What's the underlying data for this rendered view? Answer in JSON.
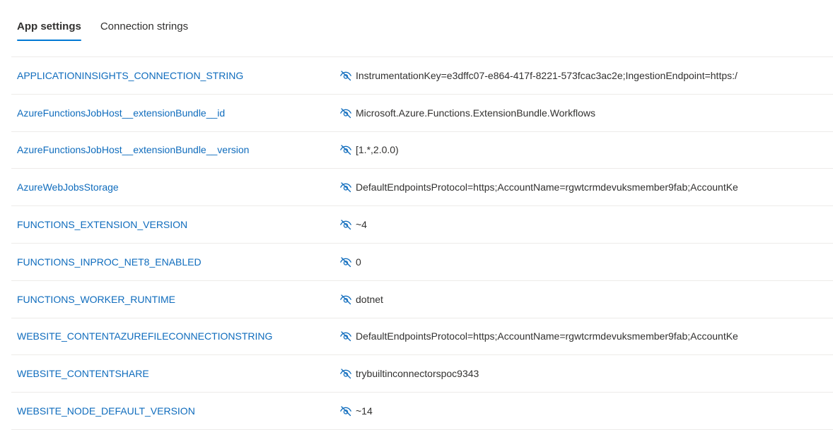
{
  "tabs": [
    {
      "label": "App settings",
      "active": true
    },
    {
      "label": "Connection strings",
      "active": false
    }
  ],
  "accent_color": "#0078d4",
  "link_color": "#0f6cbd",
  "value_icon": "eye-slash-icon",
  "settings": [
    {
      "name": "APPLICATIONINSIGHTS_CONNECTION_STRING",
      "value": "InstrumentationKey=e3dffc07-e864-417f-8221-573fcac3ac2e;IngestionEndpoint=https:/"
    },
    {
      "name": "AzureFunctionsJobHost__extensionBundle__id",
      "value": "Microsoft.Azure.Functions.ExtensionBundle.Workflows"
    },
    {
      "name": "AzureFunctionsJobHost__extensionBundle__version",
      "value": "[1.*,2.0.0)"
    },
    {
      "name": "AzureWebJobsStorage",
      "value": "DefaultEndpointsProtocol=https;AccountName=rgwtcrmdevuksmember9fab;AccountKe"
    },
    {
      "name": "FUNCTIONS_EXTENSION_VERSION",
      "value": "~4"
    },
    {
      "name": "FUNCTIONS_INPROC_NET8_ENABLED",
      "value": "0"
    },
    {
      "name": "FUNCTIONS_WORKER_RUNTIME",
      "value": "dotnet"
    },
    {
      "name": "WEBSITE_CONTENTAZUREFILECONNECTIONSTRING",
      "value": "DefaultEndpointsProtocol=https;AccountName=rgwtcrmdevuksmember9fab;AccountKe"
    },
    {
      "name": "WEBSITE_CONTENTSHARE",
      "value": "trybuiltinconnectorspoc9343"
    },
    {
      "name": "WEBSITE_NODE_DEFAULT_VERSION",
      "value": "~14"
    }
  ]
}
